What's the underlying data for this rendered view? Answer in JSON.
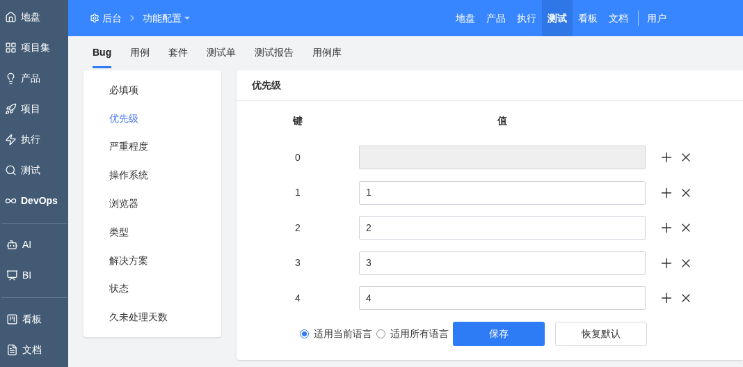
{
  "sidebar": {
    "groups": [
      [
        {
          "label": "地盘",
          "selected": false
        },
        {
          "label": "项目集",
          "selected": false
        },
        {
          "label": "产品",
          "selected": false
        },
        {
          "label": "项目",
          "selected": false
        },
        {
          "label": "执行",
          "selected": false
        },
        {
          "label": "测试",
          "selected": false
        },
        {
          "label": "DevOps",
          "selected": false
        }
      ],
      [
        {
          "label": "AI",
          "selected": false
        },
        {
          "label": "BI",
          "selected": false
        }
      ],
      [
        {
          "label": "看板",
          "selected": false
        },
        {
          "label": "文档",
          "selected": false
        }
      ]
    ]
  },
  "breadcrumb": {
    "root": "后台",
    "current": "功能配置"
  },
  "top_nav": {
    "items": [
      {
        "label": "地盘",
        "selected": false
      },
      {
        "label": "产品",
        "selected": false
      },
      {
        "label": "执行",
        "selected": false
      },
      {
        "label": "测试",
        "selected": true
      },
      {
        "label": "看板",
        "selected": false
      },
      {
        "label": "文档",
        "selected": false
      }
    ],
    "user": "用户"
  },
  "tabs": [
    {
      "label": "Bug",
      "selected": true
    },
    {
      "label": "用例",
      "selected": false
    },
    {
      "label": "套件",
      "selected": false
    },
    {
      "label": "测试单",
      "selected": false
    },
    {
      "label": "测试报告",
      "selected": false
    },
    {
      "label": "用例库",
      "selected": false
    }
  ],
  "menu": [
    {
      "label": "必填项",
      "selected": false
    },
    {
      "label": "优先级",
      "selected": true
    },
    {
      "label": "严重程度",
      "selected": false
    },
    {
      "label": "操作系统",
      "selected": false
    },
    {
      "label": "浏览器",
      "selected": false
    },
    {
      "label": "类型",
      "selected": false
    },
    {
      "label": "解决方案",
      "selected": false
    },
    {
      "label": "状态",
      "selected": false
    },
    {
      "label": "久未处理天数",
      "selected": false
    }
  ],
  "panel": {
    "title": "优先级",
    "columns": [
      "键",
      "值"
    ],
    "rows": [
      {
        "key": "0",
        "disabled": true
      },
      {
        "key": "1",
        "value": "1",
        "disabled": false
      },
      {
        "key": "2",
        "value": "2",
        "disabled": false
      },
      {
        "key": "3",
        "value": "3",
        "disabled": false
      },
      {
        "key": "4",
        "value": "4",
        "disabled": false
      }
    ],
    "scope": [
      {
        "label": "适用当前语言",
        "selected": true
      },
      {
        "label": "适用所有语言",
        "selected": false
      }
    ],
    "save": "保存",
    "reset": "恢复默认"
  }
}
